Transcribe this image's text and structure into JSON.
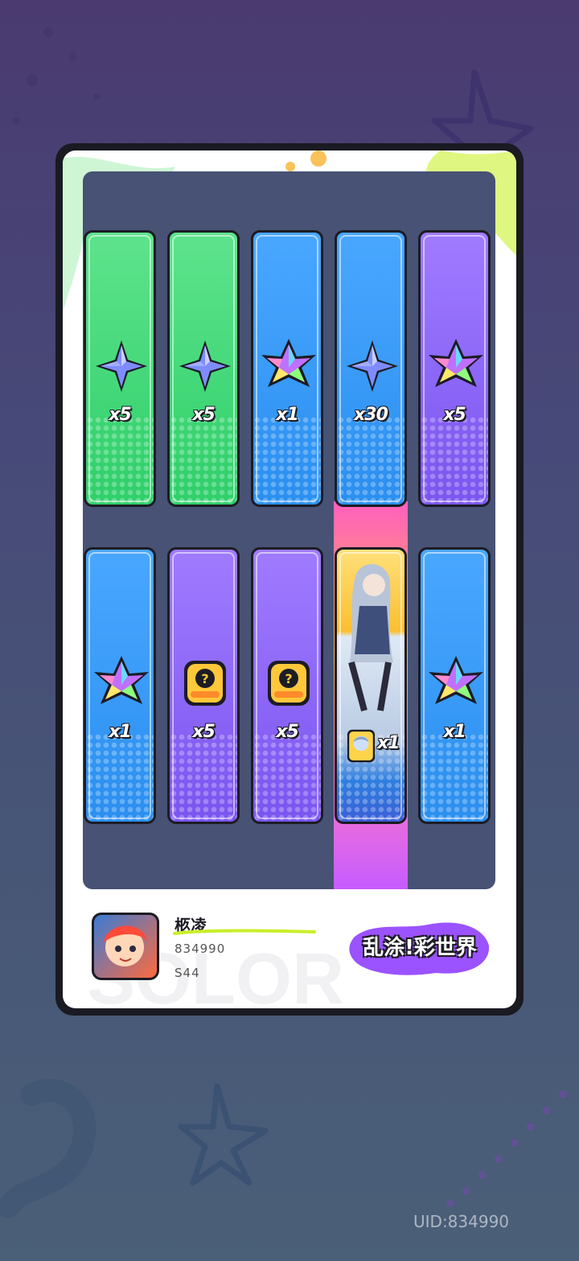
{
  "rewards": [
    {
      "color": "green",
      "icon": "blue-star-crystal-icon",
      "qty": "x5"
    },
    {
      "color": "green",
      "icon": "blue-star-crystal-icon",
      "qty": "x5"
    },
    {
      "color": "blue",
      "icon": "rainbow-star-crystal-icon",
      "qty": "x1"
    },
    {
      "color": "blue",
      "icon": "blue-star-crystal-icon",
      "qty": "x30"
    },
    {
      "color": "purple",
      "icon": "rainbow-star-crystal-icon",
      "qty": "x5"
    },
    {
      "color": "blue",
      "icon": "rainbow-star-crystal-icon",
      "qty": "x1"
    },
    {
      "color": "purple",
      "icon": "mystery-ticket-icon",
      "qty": "x5"
    },
    {
      "color": "purple",
      "icon": "mystery-ticket-icon",
      "qty": "x5"
    },
    {
      "color": "gold",
      "icon": "character-card-icon",
      "qty": "x1"
    },
    {
      "color": "blue",
      "icon": "rainbow-star-crystal-icon",
      "qty": "x1"
    }
  ],
  "player": {
    "name": "柩凌",
    "id": "834990",
    "server": "S44"
  },
  "logo": {
    "text": "乱涂!彩世界"
  },
  "footer": {
    "uid": "UID:834990"
  },
  "colors": {
    "green": "#3fd97b",
    "blue": "#3a9bf7",
    "purple": "#8c66f7",
    "gold": "#fbbf2f"
  }
}
